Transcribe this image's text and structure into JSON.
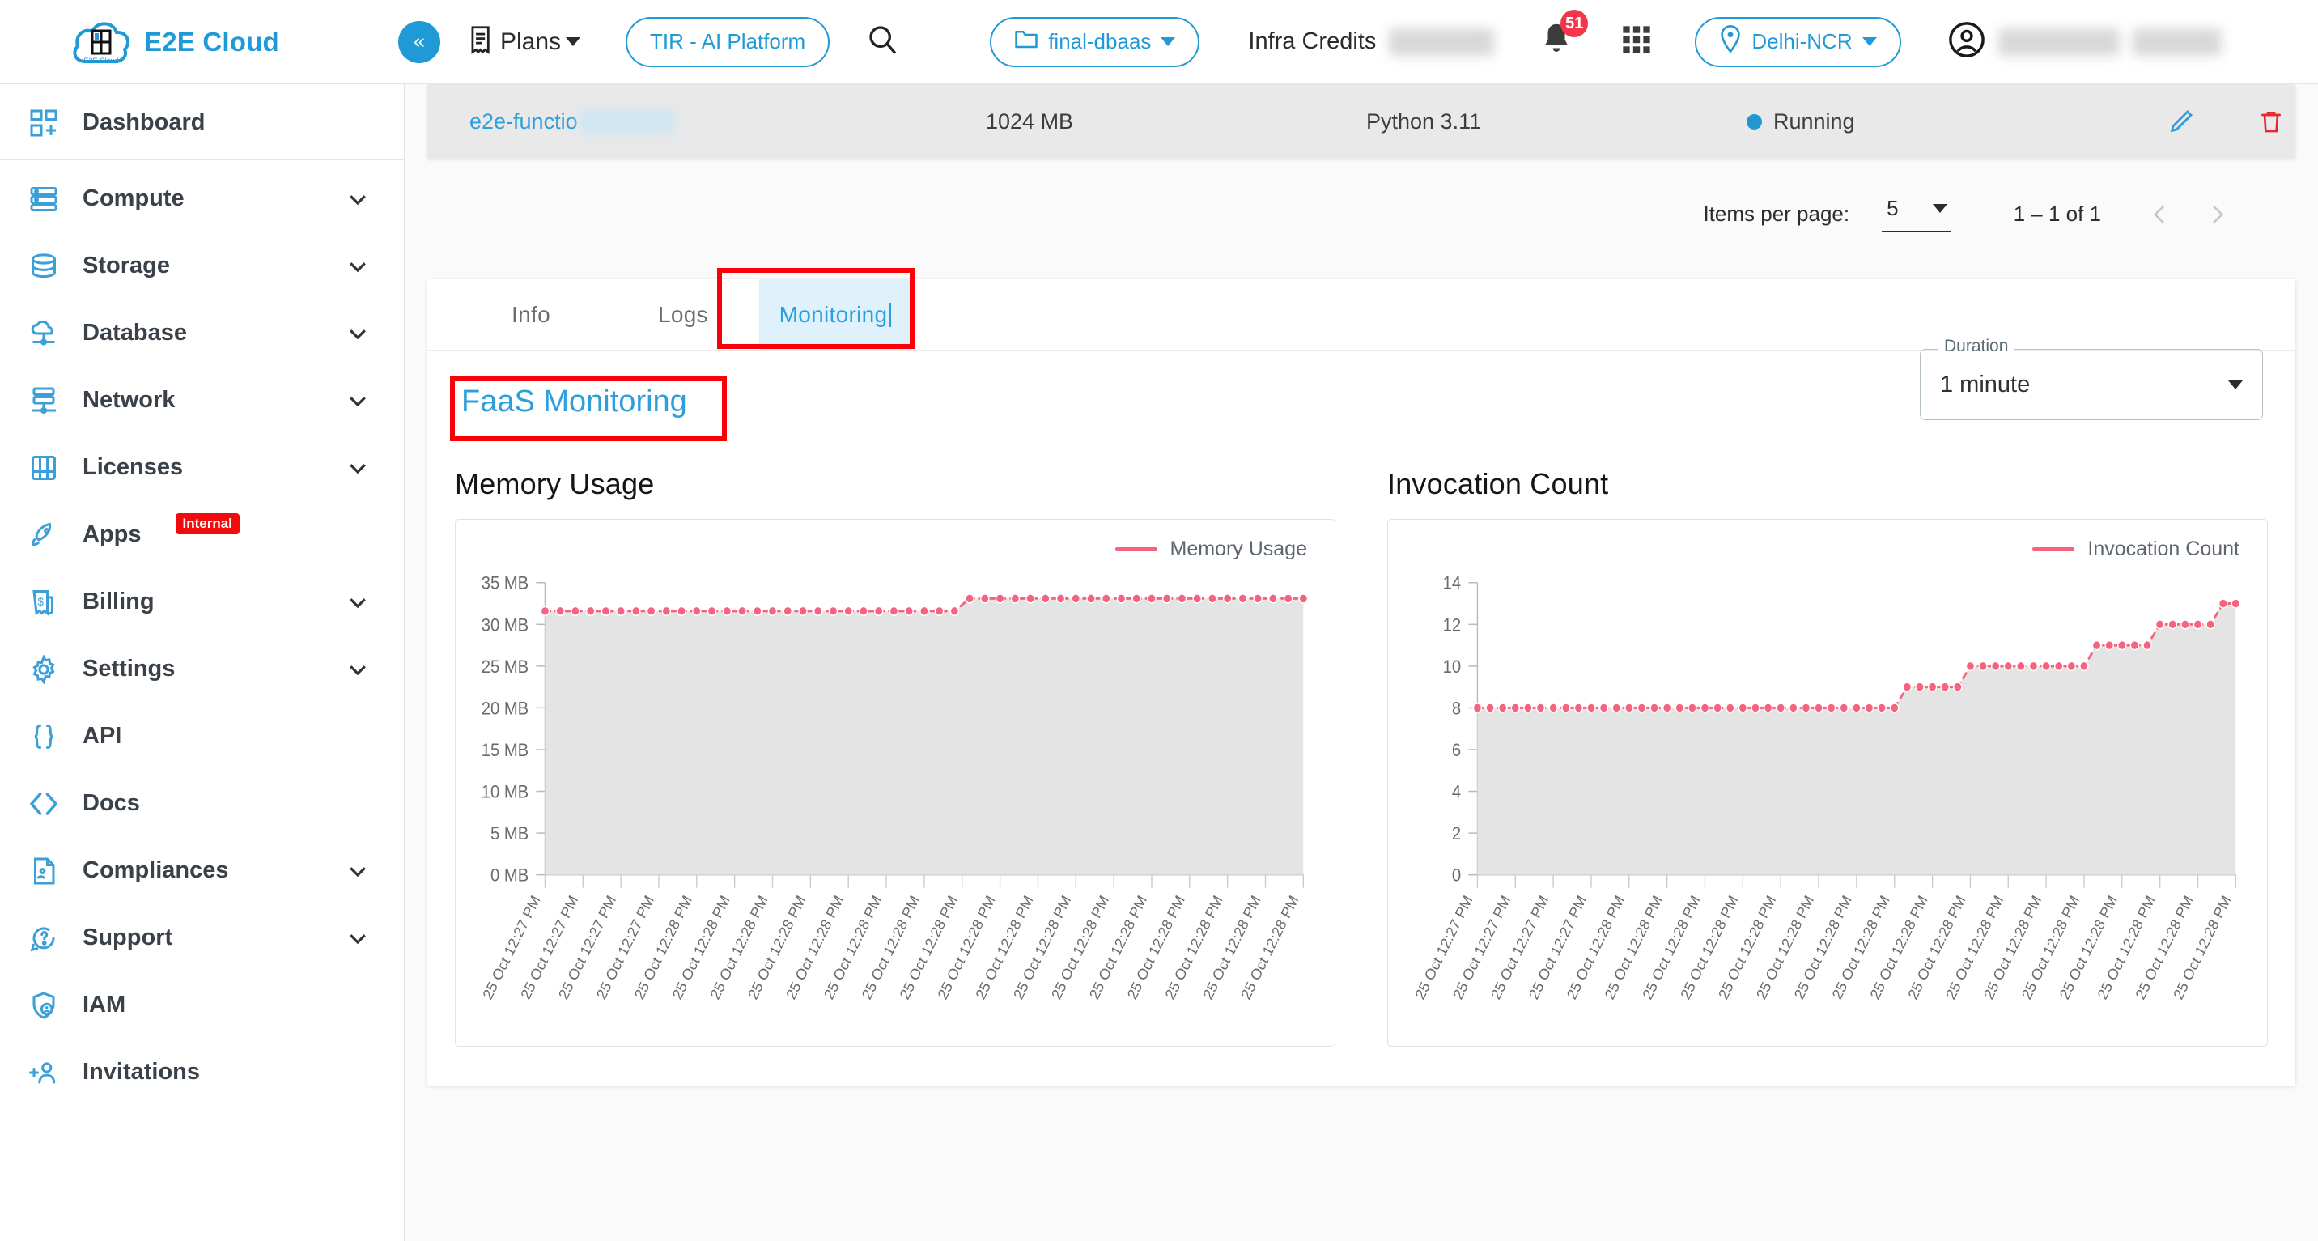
{
  "topbar": {
    "brand": "E2E Cloud",
    "logo_caption": "E2E Cloud",
    "collapse_glyph": "«",
    "plans_label": "Plans",
    "tir_label": "TIR - AI Platform",
    "project_label": "final-dbaas",
    "infra_credits_label": "Infra Credits",
    "notifications_count": "51",
    "region_label": "Delhi-NCR"
  },
  "sidebar": {
    "items": [
      {
        "label": "Dashboard",
        "icon": "dashboard-icon",
        "expandable": false,
        "tag": null
      },
      {
        "label": "Compute",
        "icon": "server-icon",
        "expandable": true,
        "tag": null
      },
      {
        "label": "Storage",
        "icon": "database-icon",
        "expandable": true,
        "tag": null
      },
      {
        "label": "Database",
        "icon": "cloud-db-icon",
        "expandable": true,
        "tag": null
      },
      {
        "label": "Network",
        "icon": "network-icon",
        "expandable": true,
        "tag": null
      },
      {
        "label": "Licenses",
        "icon": "licenses-icon",
        "expandable": true,
        "tag": null
      },
      {
        "label": "Apps",
        "icon": "rocket-icon",
        "expandable": false,
        "tag": "Internal"
      },
      {
        "label": "Billing",
        "icon": "billing-icon",
        "expandable": true,
        "tag": null
      },
      {
        "label": "Settings",
        "icon": "gear-icon",
        "expandable": true,
        "tag": null
      },
      {
        "label": "API",
        "icon": "braces-icon",
        "expandable": false,
        "tag": null
      },
      {
        "label": "Docs",
        "icon": "code-icon",
        "expandable": false,
        "tag": null
      },
      {
        "label": "Compliances",
        "icon": "document-icon",
        "expandable": true,
        "tag": null
      },
      {
        "label": "Support",
        "icon": "chat-help-icon",
        "expandable": true,
        "tag": null
      },
      {
        "label": "IAM",
        "icon": "shield-user-icon",
        "expandable": false,
        "tag": null
      },
      {
        "label": "Invitations",
        "icon": "add-user-icon",
        "expandable": false,
        "tag": null
      }
    ]
  },
  "table": {
    "row": {
      "name": "e2e-functio",
      "memory": "1024 MB",
      "runtime": "Python 3.11",
      "status": "Running",
      "status_color": "#2196d3"
    }
  },
  "paginator": {
    "items_per_page_label": "Items per page:",
    "items_per_page_value": "5",
    "range_label": "1 – 1 of 1"
  },
  "panel": {
    "tabs": [
      {
        "label": "Info",
        "active": false
      },
      {
        "label": "Logs",
        "active": false
      },
      {
        "label": "Monitoring",
        "active": true
      }
    ],
    "title": "FaaS Monitoring",
    "duration": {
      "legend": "Duration",
      "value": "1 minute"
    }
  },
  "chart_data": [
    {
      "type": "area",
      "title": "Memory Usage",
      "legend": [
        "Memory Usage"
      ],
      "legend_position": "top-right",
      "series_color": "#f4647f",
      "xlabel": "",
      "ylabel": "",
      "ylim": [
        0,
        35
      ],
      "yticks": [
        0,
        5,
        10,
        15,
        20,
        25,
        30,
        35
      ],
      "ytick_labels": [
        "0 MB",
        "5 MB",
        "10 MB",
        "15 MB",
        "20 MB",
        "25 MB",
        "30 MB",
        "35 MB"
      ],
      "grid": false,
      "x": [
        "25 Oct 12:27 PM",
        "25 Oct 12:27 PM",
        "25 Oct 12:27 PM",
        "25 Oct 12:27 PM",
        "25 Oct 12:28 PM",
        "25 Oct 12:28 PM",
        "25 Oct 12:28 PM",
        "25 Oct 12:28 PM",
        "25 Oct 12:28 PM",
        "25 Oct 12:28 PM",
        "25 Oct 12:28 PM",
        "25 Oct 12:28 PM",
        "25 Oct 12:28 PM",
        "25 Oct 12:28 PM",
        "25 Oct 12:28 PM",
        "25 Oct 12:28 PM",
        "25 Oct 12:28 PM",
        "25 Oct 12:28 PM",
        "25 Oct 12:28 PM",
        "25 Oct 12:28 PM",
        "25 Oct 12:28 PM"
      ],
      "series": [
        {
          "name": "Memory Usage",
          "values": [
            31.6,
            31.6,
            31.6,
            31.6,
            31.6,
            31.6,
            31.6,
            31.6,
            31.6,
            31.6,
            31.6,
            31.6,
            31.6,
            31.6,
            31.6,
            31.6,
            31.6,
            31.6,
            31.6,
            31.6,
            31.6,
            31.6,
            31.6,
            31.6,
            31.6,
            31.6,
            31.6,
            31.6,
            33.1,
            33.1,
            33.1,
            33.1,
            33.1,
            33.1,
            33.1,
            33.1,
            33.1,
            33.1,
            33.1,
            33.1,
            33.1,
            33.1,
            33.1,
            33.1,
            33.1,
            33.1,
            33.1,
            33.1,
            33.1,
            33.1,
            33.1
          ]
        }
      ]
    },
    {
      "type": "area",
      "title": "Invocation Count",
      "legend": [
        "Invocation Count"
      ],
      "legend_position": "top-right",
      "series_color": "#f4647f",
      "xlabel": "",
      "ylabel": "",
      "ylim": [
        0,
        14
      ],
      "yticks": [
        0,
        2,
        4,
        6,
        8,
        10,
        12,
        14
      ],
      "ytick_labels": [
        "0",
        "2",
        "4",
        "6",
        "8",
        "10",
        "12",
        "14"
      ],
      "grid": false,
      "x": [
        "25 Oct 12:27 PM",
        "25 Oct 12:27 PM",
        "25 Oct 12:27 PM",
        "25 Oct 12:27 PM",
        "25 Oct 12:28 PM",
        "25 Oct 12:28 PM",
        "25 Oct 12:28 PM",
        "25 Oct 12:28 PM",
        "25 Oct 12:28 PM",
        "25 Oct 12:28 PM",
        "25 Oct 12:28 PM",
        "25 Oct 12:28 PM",
        "25 Oct 12:28 PM",
        "25 Oct 12:28 PM",
        "25 Oct 12:28 PM",
        "25 Oct 12:28 PM",
        "25 Oct 12:28 PM",
        "25 Oct 12:28 PM",
        "25 Oct 12:28 PM",
        "25 Oct 12:28 PM",
        "25 Oct 12:28 PM"
      ],
      "series": [
        {
          "name": "Invocation Count",
          "values": [
            8,
            8,
            8,
            8,
            8,
            8,
            8,
            8,
            8,
            8,
            8,
            8,
            8,
            8,
            8,
            8,
            8,
            8,
            8,
            8,
            8,
            8,
            8,
            8,
            8,
            8,
            8,
            8,
            8,
            8,
            8,
            8,
            8,
            8,
            9,
            9,
            9,
            9,
            9,
            10,
            10,
            10,
            10,
            10,
            10,
            10,
            10,
            10,
            10,
            11,
            11,
            11,
            11,
            11,
            12,
            12,
            12,
            12,
            12,
            13,
            13
          ]
        }
      ]
    }
  ]
}
